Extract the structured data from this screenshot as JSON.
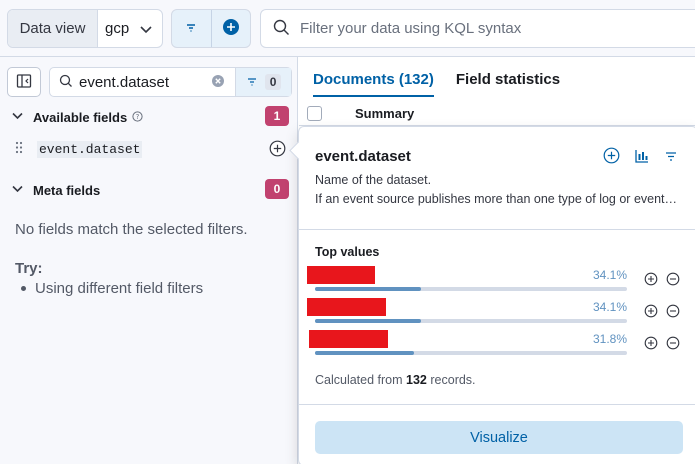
{
  "topbar": {
    "data_view_label": "Data view",
    "data_view_value": "gcp",
    "kql_placeholder": "Filter your data using KQL syntax"
  },
  "sidebar": {
    "search_value": "event.dataset",
    "filter_count": "0",
    "available_label": "Available fields",
    "available_count": "1",
    "field_name": "event.dataset",
    "meta_label": "Meta fields",
    "meta_count": "0",
    "empty_message": "No fields match the selected filters.",
    "try_label": "Try:",
    "try_tip": "Using different field filters"
  },
  "main": {
    "tabs": [
      {
        "label": "Documents (132)",
        "active": true
      },
      {
        "label": "Field statistics",
        "active": false
      }
    ],
    "grid_column": "Summary"
  },
  "popover": {
    "title": "event.dataset",
    "description_1": "Name of the dataset.",
    "description_2": "If an event source publishes more than one type of log or events (e.g. access log, error log), the dataset is used to specify which one the event comes from.",
    "top_values_title": "Top values",
    "top_values": [
      {
        "label_redacted": true,
        "percent_text": "34.1%",
        "percent": 34.1
      },
      {
        "label_redacted": true,
        "percent_text": "34.1%",
        "percent": 34.1
      },
      {
        "label_redacted": true,
        "percent_text": "31.8%",
        "percent": 31.8
      }
    ],
    "calc_prefix": "Calculated from",
    "calc_count": "132",
    "calc_suffix": "records.",
    "visualize_label": "Visualize"
  },
  "colors": {
    "accent": "#0061a6",
    "badge": "#c1426f",
    "bar": "#6092c0",
    "redaction": "#e8161c"
  },
  "icons": [
    "chevron-down-icon",
    "filter-icon",
    "plus-circle-icon",
    "search-icon",
    "collapse-sidebar-icon",
    "clear-icon",
    "question-icon",
    "drag-handle-icon",
    "chart-icon",
    "minus-circle-icon"
  ]
}
